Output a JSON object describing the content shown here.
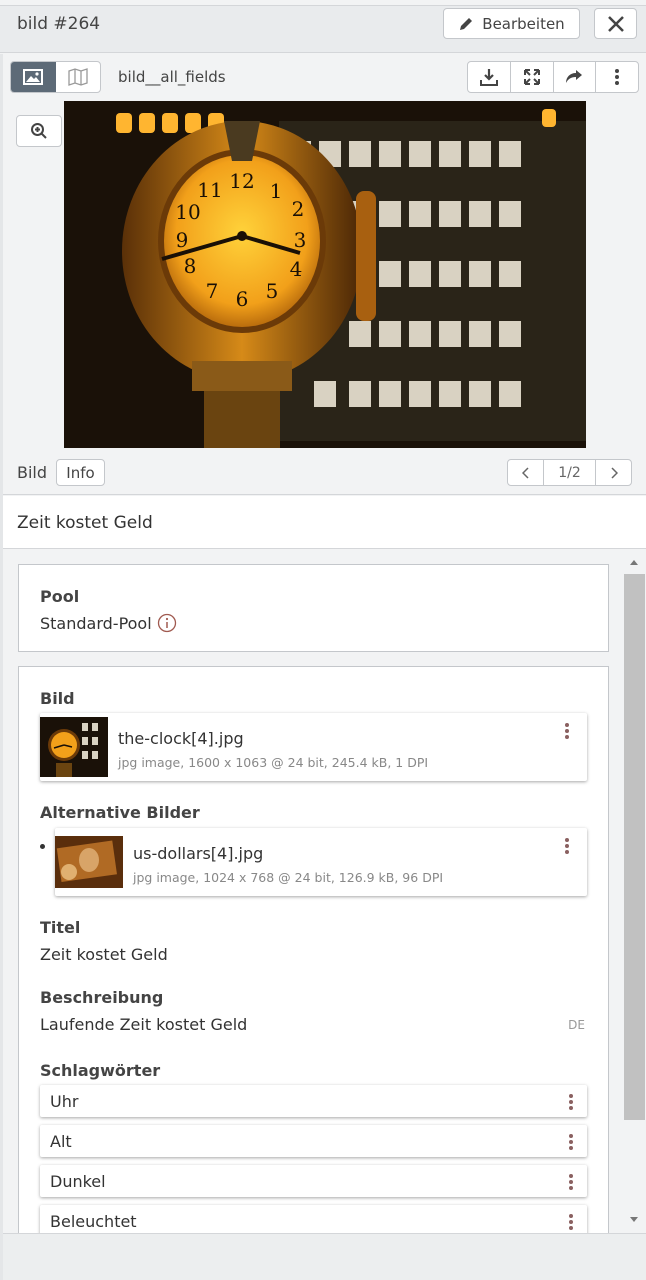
{
  "header": {
    "title": "bild #264",
    "edit_label": "Bearbeiten"
  },
  "toolbar": {
    "mask_name": "bild__all_fields"
  },
  "version_bar": {
    "label": "Bild",
    "info_label": "Info",
    "page": "1/2"
  },
  "record_title": "Zeit kostet Geld",
  "pool": {
    "label": "Pool",
    "value": "Standard-Pool"
  },
  "bild": {
    "label": "Bild",
    "file_name": "the-clock[4].jpg",
    "file_meta": "jpg image,  1600 x 1063 @ 24 bit,  245.4 kB,  1 DPI"
  },
  "alt_bilder": {
    "label": "Alternative Bilder",
    "file_name": "us-dollars[4].jpg",
    "file_meta": "jpg image,  1024 x 768 @ 24 bit,  126.9 kB,  96 DPI"
  },
  "titel": {
    "label": "Titel",
    "value": "Zeit kostet Geld"
  },
  "beschreibung": {
    "label": "Beschreibung",
    "value": "Laufende Zeit kostet Geld",
    "lang": "DE"
  },
  "schlagwoerter": {
    "label": "Schlagwörter",
    "items": [
      "Uhr",
      "Alt",
      "Dunkel",
      "Beleuchtet"
    ]
  },
  "colors": {
    "accent": "#5d6a77",
    "kebab": "#8a6060"
  }
}
